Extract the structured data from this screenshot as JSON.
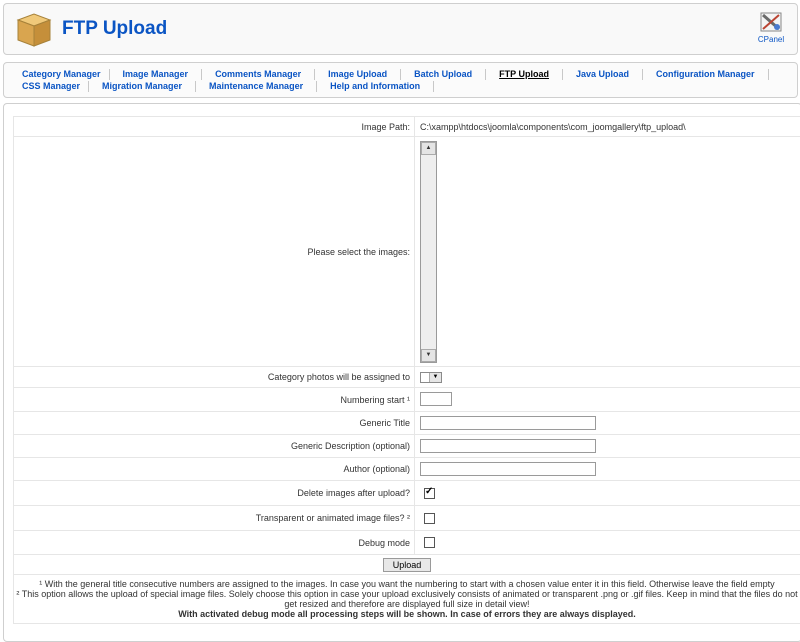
{
  "header": {
    "title": "FTP Upload",
    "cpanel_label": "CPanel"
  },
  "nav": {
    "row1": [
      "Category Manager",
      "Image Manager",
      "Comments Manager",
      "Image Upload",
      "Batch Upload",
      "FTP Upload",
      "Java Upload",
      "Configuration Manager"
    ],
    "row2": [
      "CSS Manager",
      "Migration Manager",
      "Maintenance Manager",
      "Help and Information"
    ],
    "active": "FTP Upload"
  },
  "form": {
    "image_path_label": "Image Path:",
    "image_path_value": "C:\\xampp\\htdocs\\joomla\\components\\com_joomgallery\\ftp_upload\\",
    "select_images_label": "Please select the images:",
    "category_label": "Category photos will be assigned to",
    "numbering_label": "Numbering start ¹",
    "generic_title_label": "Generic Title",
    "generic_desc_label": "Generic Description (optional)",
    "author_label": "Author (optional)",
    "delete_label": "Delete images after upload?",
    "delete_checked": true,
    "transparent_label": "Transparent or animated image files? ²",
    "transparent_checked": false,
    "debug_label": "Debug mode",
    "debug_checked": false,
    "upload_button": "Upload"
  },
  "notes": {
    "note1": "¹ With the general title consecutive numbers are assigned to the images. In case you want the numbering to start with a chosen value enter it in this field. Otherwise leave the field empty",
    "note2": "² This option allows the upload of special image files. Solely choose this option in case your upload exclusively consists of animated or transparent .png or .gif files. Keep in mind that the files do not get resized and therefore are displayed full size in detail view!",
    "note3": "With activated debug mode all processing steps will be shown. In case of errors they are always displayed."
  }
}
